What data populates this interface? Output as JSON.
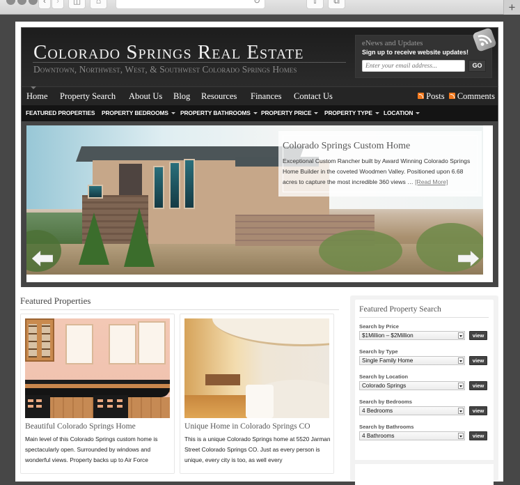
{
  "browser": {
    "back_icon": "chevron-left",
    "forward_icon": "chevron-right",
    "sidebar_icon": "sidebar",
    "home_icon": "home",
    "reload_icon": "reload",
    "share_icon": "share",
    "tabs_icon": "tabs",
    "new_tab_label": "+"
  },
  "header": {
    "title": "Colorado Springs Real Estate",
    "subtitle": "Downtown, Northwest, West, & Southwest Colorado Springs Homes"
  },
  "enews": {
    "title": "eNews and Updates",
    "description": "Sign up to receive website updates!",
    "email_placeholder": "Enter your email address...",
    "go_label": "GO",
    "icon": "rss-icon"
  },
  "nav": {
    "items": [
      {
        "label": "Home"
      },
      {
        "label": "Property Search"
      },
      {
        "label": "About Us"
      },
      {
        "label": "Blog"
      },
      {
        "label": "Resources"
      },
      {
        "label": "Finances"
      },
      {
        "label": "Contact Us"
      }
    ],
    "feeds": [
      {
        "label": "Posts"
      },
      {
        "label": "Comments"
      }
    ]
  },
  "subnav": {
    "items": [
      {
        "label": "FEATURED PROPERTIES",
        "dropdown": false
      },
      {
        "label": "PROPERTY BEDROOMS",
        "dropdown": true
      },
      {
        "label": "PROPERTY BATHROOMS",
        "dropdown": true
      },
      {
        "label": "PROPERTY PRICE",
        "dropdown": true
      },
      {
        "label": "PROPERTY TYPE",
        "dropdown": true
      },
      {
        "label": "LOCATION",
        "dropdown": true
      }
    ]
  },
  "slider": {
    "title": "Colorado Springs Custom Home",
    "text": "Exceptional Custom Rancher built by Award Winning Colorado Springs Home Builder in the coveted Woodmen Valley. Positioned upon 6.68 acres to capture the most incredible 360 views … ",
    "read_more": "[Read More]"
  },
  "featured": {
    "heading": "Featured Properties",
    "cards": [
      {
        "title": "Beautiful Colorado Springs Home",
        "text": "Main level of this Colorado Springs custom home is spectacularly open. Surrounded by windows and wonderful views. Property backs up to Air Force"
      },
      {
        "title": "Unique Home in Colorado Springs CO",
        "text": "This is a unique Colorado Springs home at 5520 Jarman Street Colorado Springs CO. Just as every person is unique, every city is too, as well every"
      }
    ]
  },
  "search": {
    "heading": "Featured Property Search",
    "view_label": "view",
    "groups": [
      {
        "label": "Search by Price",
        "value": "$1Million – $2Million"
      },
      {
        "label": "Search by Type",
        "value": "Single Family Home"
      },
      {
        "label": "Search by Location",
        "value": "Colorado Springs"
      },
      {
        "label": "Search by Bedrooms",
        "value": "4 Bedrooms"
      },
      {
        "label": "Search by Bathrooms",
        "value": "4 Bathrooms"
      }
    ]
  },
  "colors": {
    "header_bg": "#1d1d1d",
    "rss_orange": "#f47b20",
    "button_dark": "#444444",
    "outer_bg": "#474747"
  }
}
